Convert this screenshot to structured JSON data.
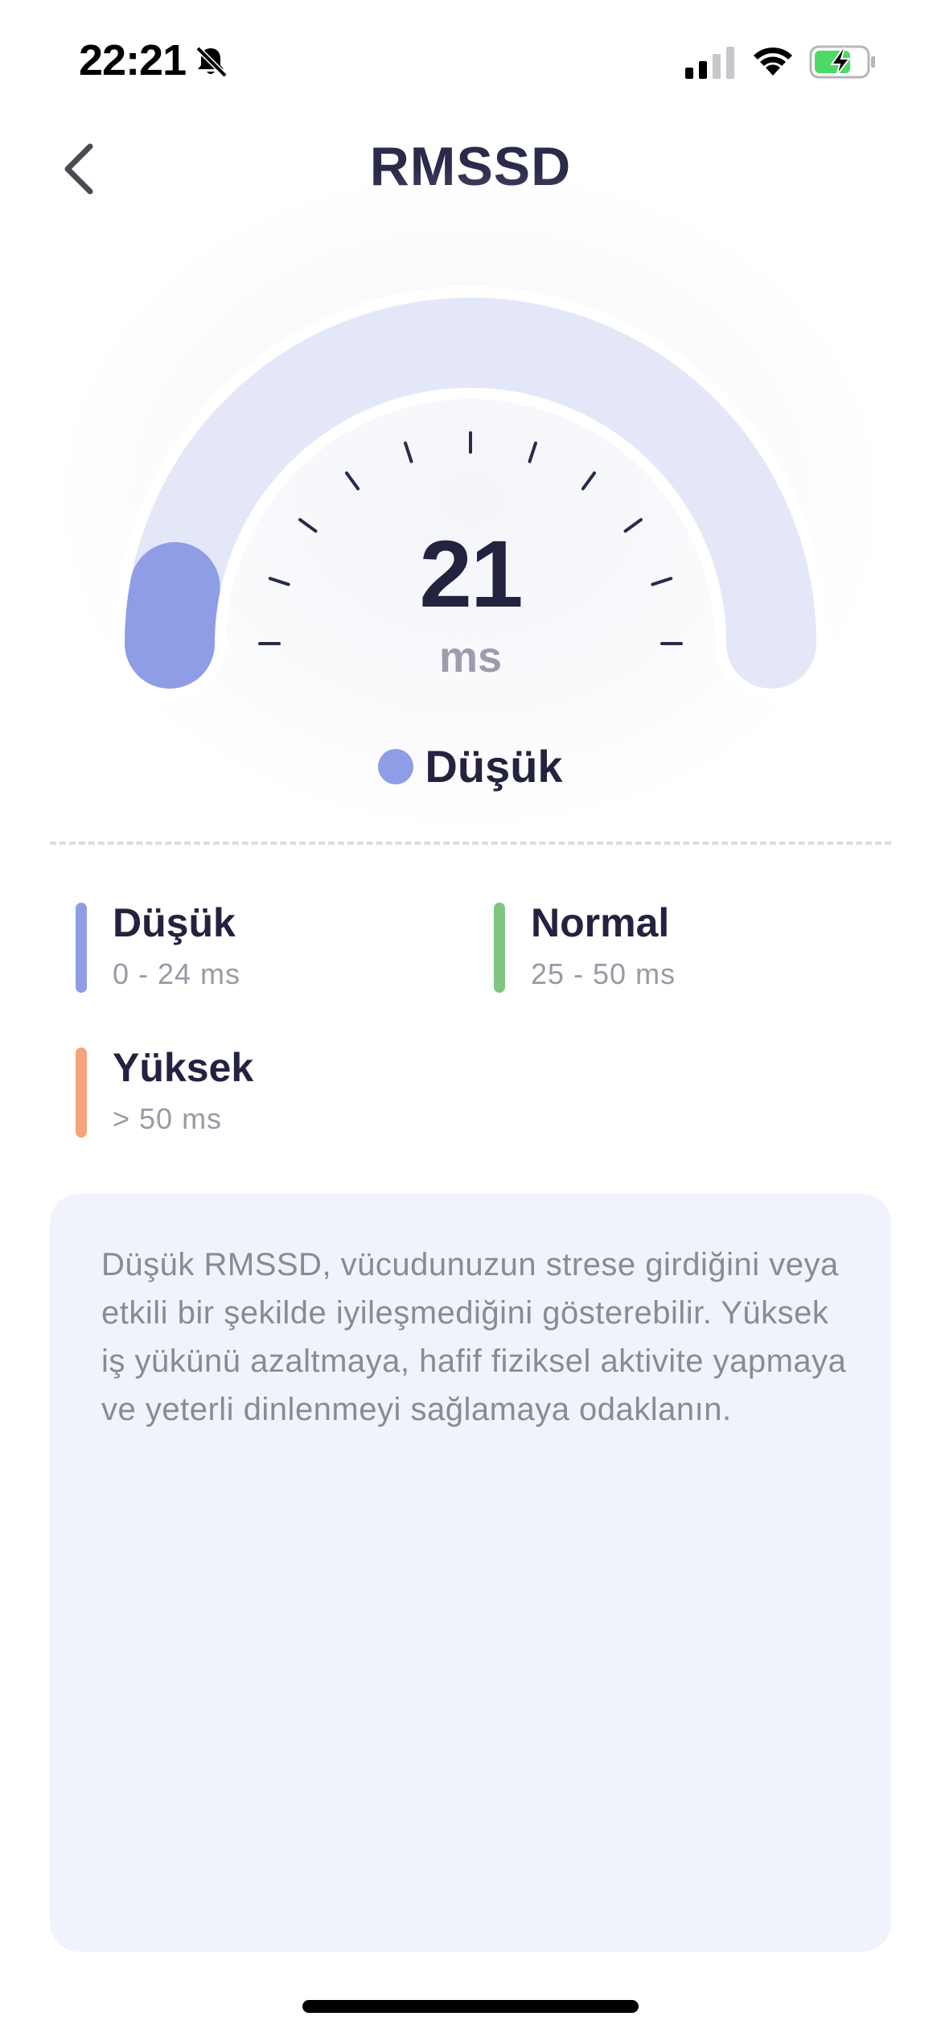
{
  "status_bar": {
    "time": "22:21",
    "icons": [
      "bell-slash-icon",
      "cellular-signal-icon",
      "wifi-icon",
      "battery-charging-icon"
    ]
  },
  "header": {
    "back_icon": "chevron-left-icon",
    "title": "RMSSD"
  },
  "gauge": {
    "value": "21",
    "unit": "ms",
    "level_fraction": 0.06,
    "status_label": "Düşük",
    "colors": {
      "track": "#e3e7f8",
      "fill": "#8e9de6",
      "ticks": "#2a2a4a"
    }
  },
  "legend": {
    "items": [
      {
        "title": "Düşük",
        "range": "0 - 24 ms",
        "color": "#8e9de6"
      },
      {
        "title": "Normal",
        "range": "25 - 50 ms",
        "color": "#7fc683"
      },
      {
        "title": "Yüksek",
        "range": "> 50 ms",
        "color": "#f6a27a"
      }
    ]
  },
  "info": {
    "text": "Düşük RMSSD, vücudunuzun strese girdiğini veya etkili bir şekilde iyileşmediğini gösterebilir. Yüksek iş yükünü azaltmaya, hafif fiziksel aktivite yapmaya ve yeterli dinlenmeyi sağlamaya odaklanın."
  }
}
